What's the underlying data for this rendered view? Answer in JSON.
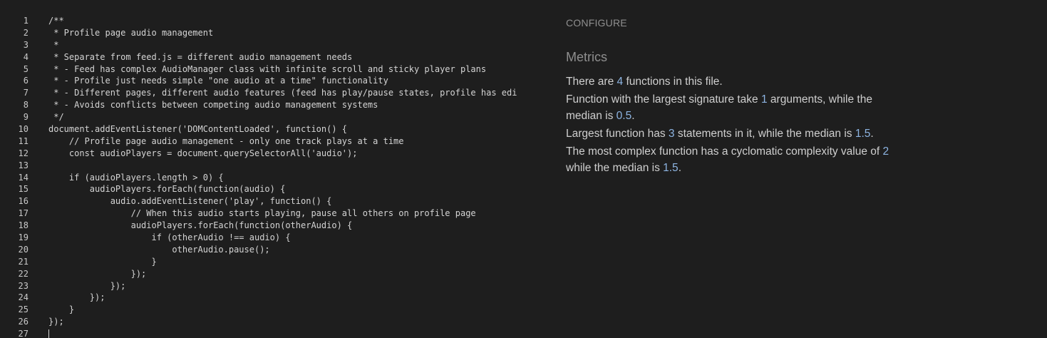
{
  "editor": {
    "lines": [
      {
        "n": "1",
        "text": "/**"
      },
      {
        "n": "2",
        "text": " * Profile page audio management"
      },
      {
        "n": "3",
        "text": " *"
      },
      {
        "n": "4",
        "text": " * Separate from feed.js = different audio management needs"
      },
      {
        "n": "5",
        "text": " * - Feed has complex AudioManager class with infinite scroll and sticky player plans"
      },
      {
        "n": "6",
        "text": " * - Profile just needs simple \"one audio at a time\" functionality"
      },
      {
        "n": "7",
        "text": " * - Different pages, different audio features (feed has play/pause states, profile has edi"
      },
      {
        "n": "8",
        "text": " * - Avoids conflicts between competing audio management systems"
      },
      {
        "n": "9",
        "text": " */"
      },
      {
        "n": "10",
        "text": "document.addEventListener('DOMContentLoaded', function() {"
      },
      {
        "n": "11",
        "text": "    // Profile page audio management - only one track plays at a time"
      },
      {
        "n": "12",
        "text": "    const audioPlayers = document.querySelectorAll('audio');"
      },
      {
        "n": "13",
        "text": ""
      },
      {
        "n": "14",
        "text": "    if (audioPlayers.length > 0) {"
      },
      {
        "n": "15",
        "text": "        audioPlayers.forEach(function(audio) {"
      },
      {
        "n": "16",
        "text": "            audio.addEventListener('play', function() {"
      },
      {
        "n": "17",
        "text": "                // When this audio starts playing, pause all others on profile page"
      },
      {
        "n": "18",
        "text": "                audioPlayers.forEach(function(otherAudio) {"
      },
      {
        "n": "19",
        "text": "                    if (otherAudio !== audio) {"
      },
      {
        "n": "20",
        "text": "                        otherAudio.pause();"
      },
      {
        "n": "21",
        "text": "                    }"
      },
      {
        "n": "22",
        "text": "                });"
      },
      {
        "n": "23",
        "text": "            });"
      },
      {
        "n": "24",
        "text": "        });"
      },
      {
        "n": "25",
        "text": "    }"
      },
      {
        "n": "26",
        "text": "});"
      },
      {
        "n": "27",
        "text": ""
      }
    ]
  },
  "panel": {
    "configure_label": "CONFIGURE",
    "metrics_title": "Metrics",
    "functions_count": {
      "pre": "There are ",
      "num": "4",
      "post": " functions in this file."
    },
    "signature": {
      "pre": "Function with the largest signature take ",
      "num1": "1",
      "mid": " arguments, while the median is ",
      "num2": "0.5",
      "post": "."
    },
    "statements": {
      "pre": "Largest function has ",
      "num1": "3",
      "mid": " statements in it, while the median is ",
      "num2": "1.5",
      "post": "."
    },
    "complexity": {
      "pre": "The most complex function has a cyclomatic complexity value of ",
      "num1": "2",
      "mid": " while the median is ",
      "num2": "1.5",
      "post": "."
    }
  },
  "colors": {
    "background": "#1e1e1e",
    "number_accent": "#8db4e2"
  }
}
